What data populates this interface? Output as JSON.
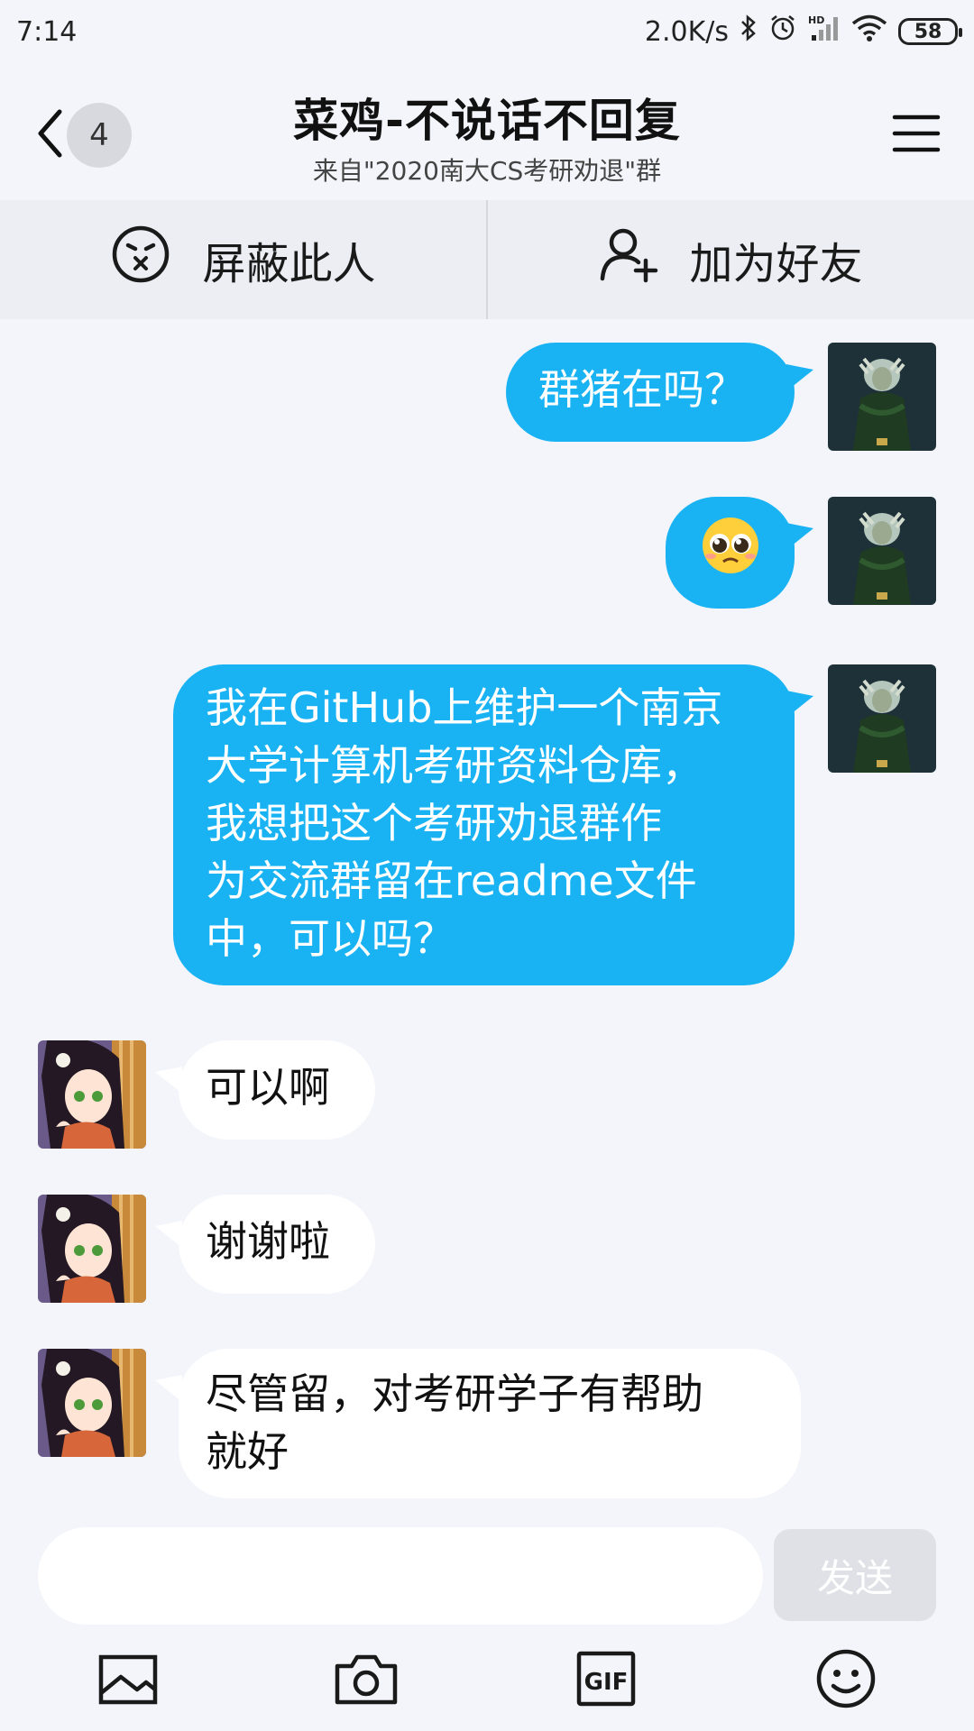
{
  "status": {
    "time": "7:14",
    "net_speed": "2.0K/s",
    "battery": "58",
    "hd_label": "HD"
  },
  "header": {
    "back_count": "4",
    "title": "菜鸡-不说话不回复",
    "subtitle": "来自\"2020南大CS考研劝退\"群"
  },
  "actions": {
    "block_label": "屏蔽此人",
    "add_friend_label": "加为好友"
  },
  "messages": [
    {
      "side": "out",
      "text": "群猪在吗？"
    },
    {
      "side": "out",
      "emoji": "pleading-face"
    },
    {
      "side": "out",
      "lines": [
        "我在GitHub上维护一个南京",
        "大学计算机考研资料仓库，",
        "我想把这个考研劝退群作",
        "为交流群留在readme文件",
        "中，可以吗？"
      ]
    },
    {
      "side": "in",
      "text": "可以啊"
    },
    {
      "side": "in",
      "text": "谢谢啦"
    },
    {
      "side": "in",
      "lines": [
        "尽管留，对考研学子有帮助",
        "就好"
      ]
    }
  ],
  "input": {
    "value": "",
    "send_label": "发送"
  },
  "toolbar": {
    "gif_label": "GIF"
  },
  "colors": {
    "outgoing_bubble": "#19b3f4",
    "incoming_bubble": "#ffffff",
    "background": "#f3f5fa"
  }
}
